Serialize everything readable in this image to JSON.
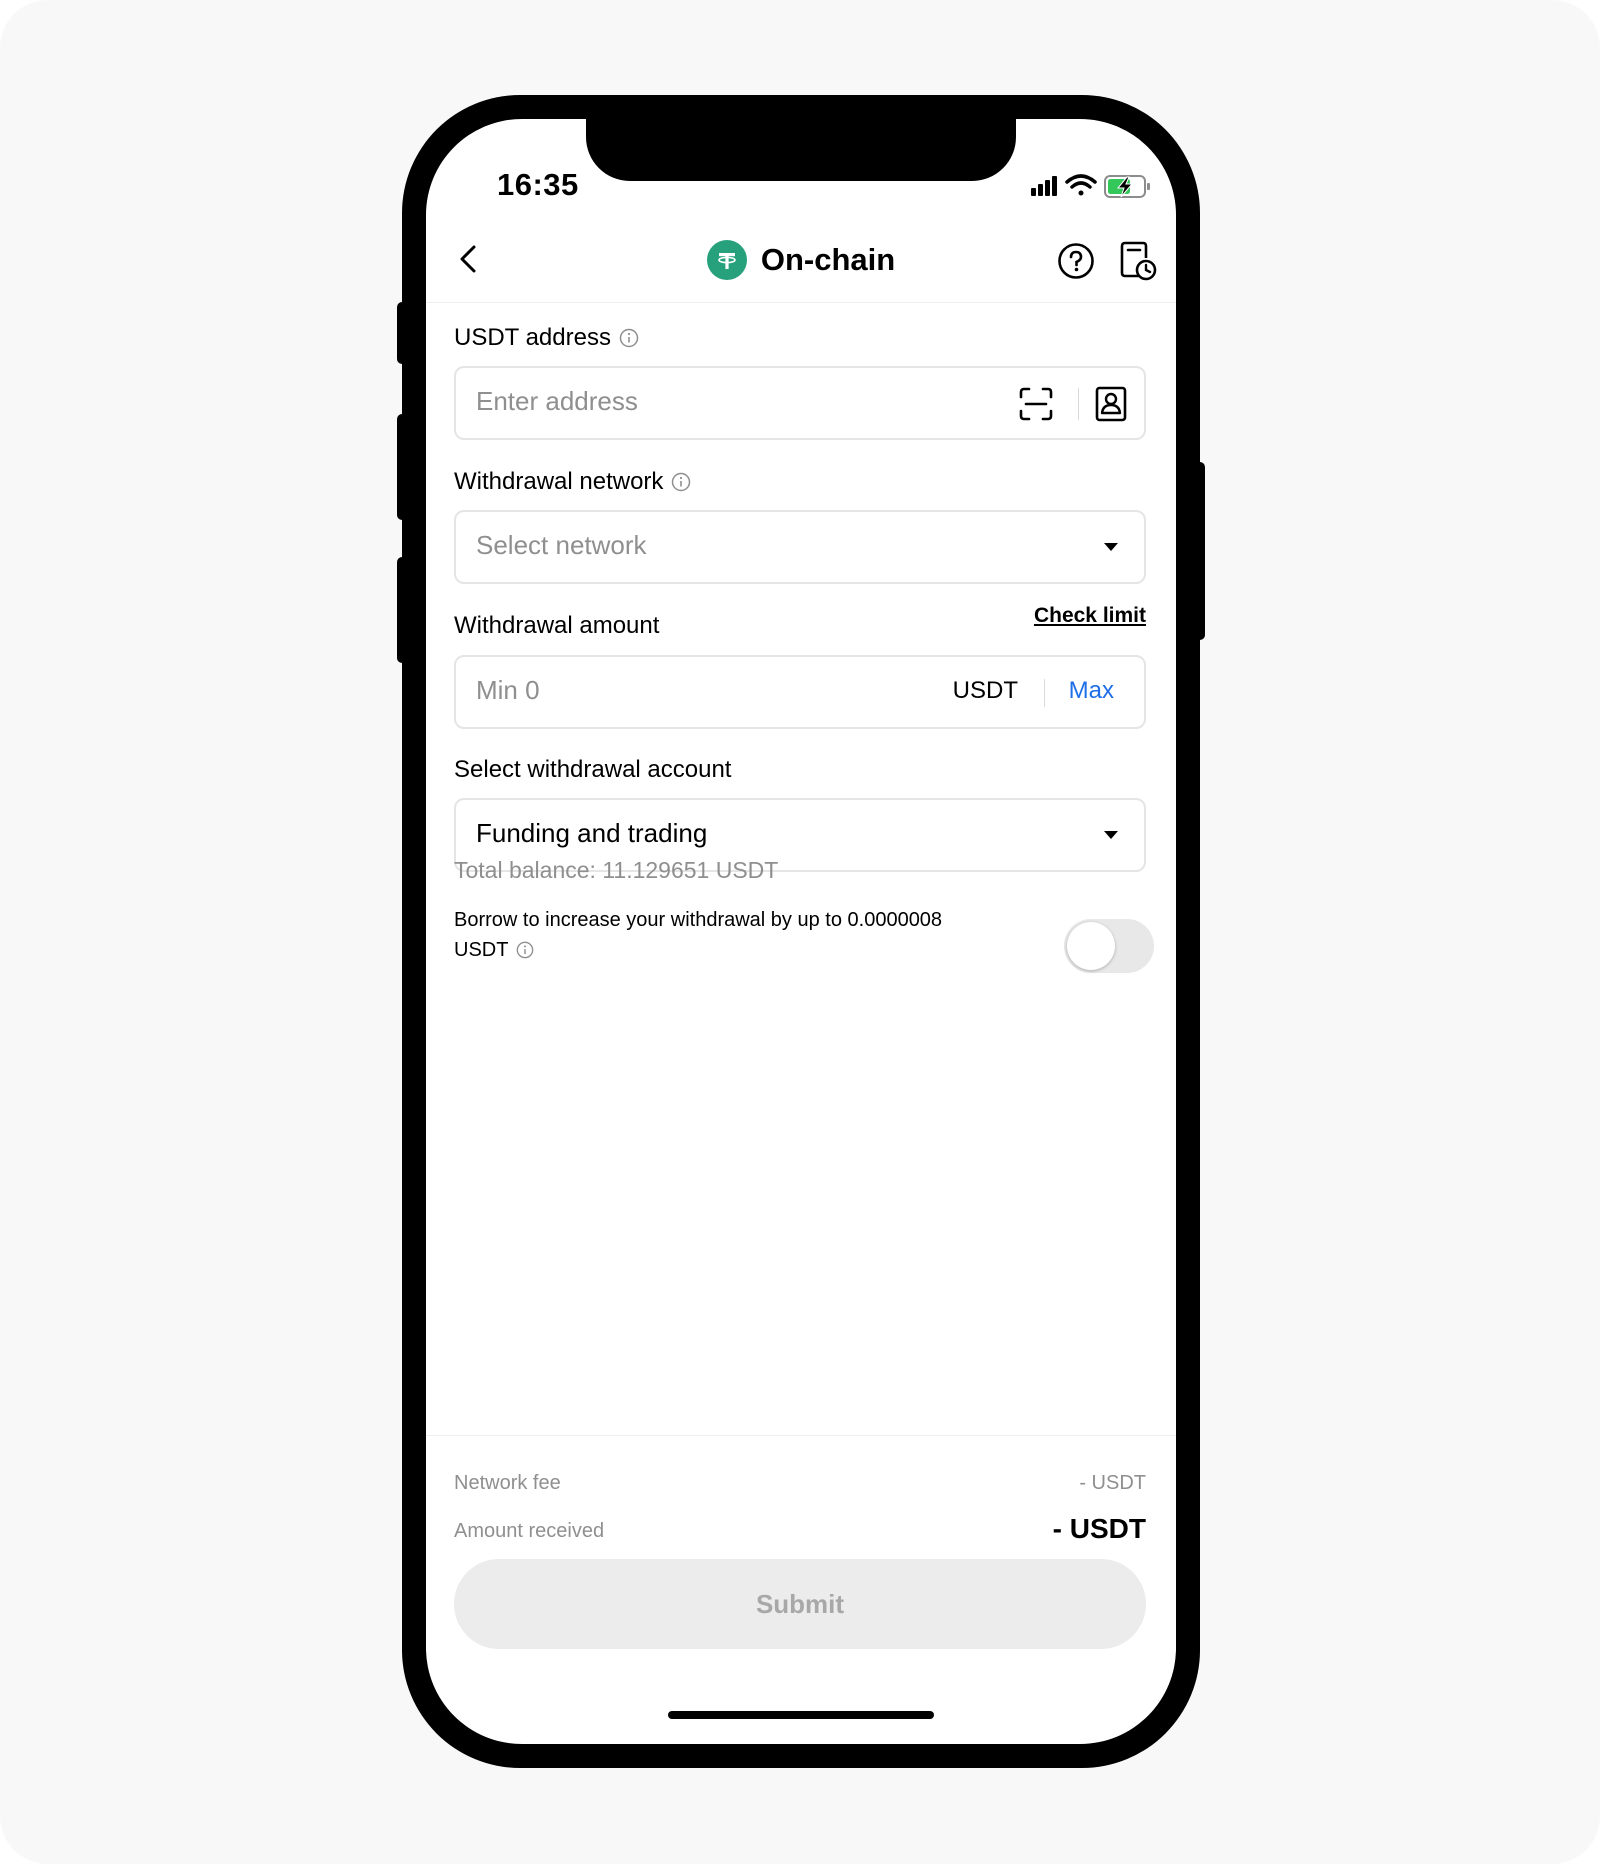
{
  "status_bar": {
    "time": "16:35",
    "icons": [
      "signal-icon",
      "wifi-icon",
      "battery-charging-icon"
    ]
  },
  "nav": {
    "title": "On-chain",
    "coin_icon": "tether-icon",
    "back_icon": "chevron-left-icon",
    "help_icon": "question-circle-icon",
    "history_icon": "document-clock-icon"
  },
  "address": {
    "label": "USDT address",
    "placeholder": "Enter address",
    "scan_icon": "scan-icon",
    "address_book_icon": "contact-book-icon"
  },
  "network": {
    "label": "Withdrawal network",
    "placeholder": "Select network"
  },
  "amount": {
    "label": "Withdrawal amount",
    "check_limit": "Check limit",
    "placeholder": "Min 0",
    "unit": "USDT",
    "max_label": "Max"
  },
  "account": {
    "label": "Select withdrawal account",
    "value": "Funding and trading",
    "balance": "Total balance: 11.129651 USDT"
  },
  "borrow": {
    "text_line1": "Borrow to increase your withdrawal by up to 0.0000008",
    "text_line2": "USDT",
    "enabled": false
  },
  "summary": {
    "fee_label": "Network fee",
    "fee_value": "- USDT",
    "received_label": "Amount received",
    "received_value": "- USDT"
  },
  "submit": {
    "label": "Submit"
  },
  "colors": {
    "accent": "#1e6ee8",
    "tether": "#26a17b",
    "muted": "#8f8f8f",
    "battery": "#34c759"
  }
}
